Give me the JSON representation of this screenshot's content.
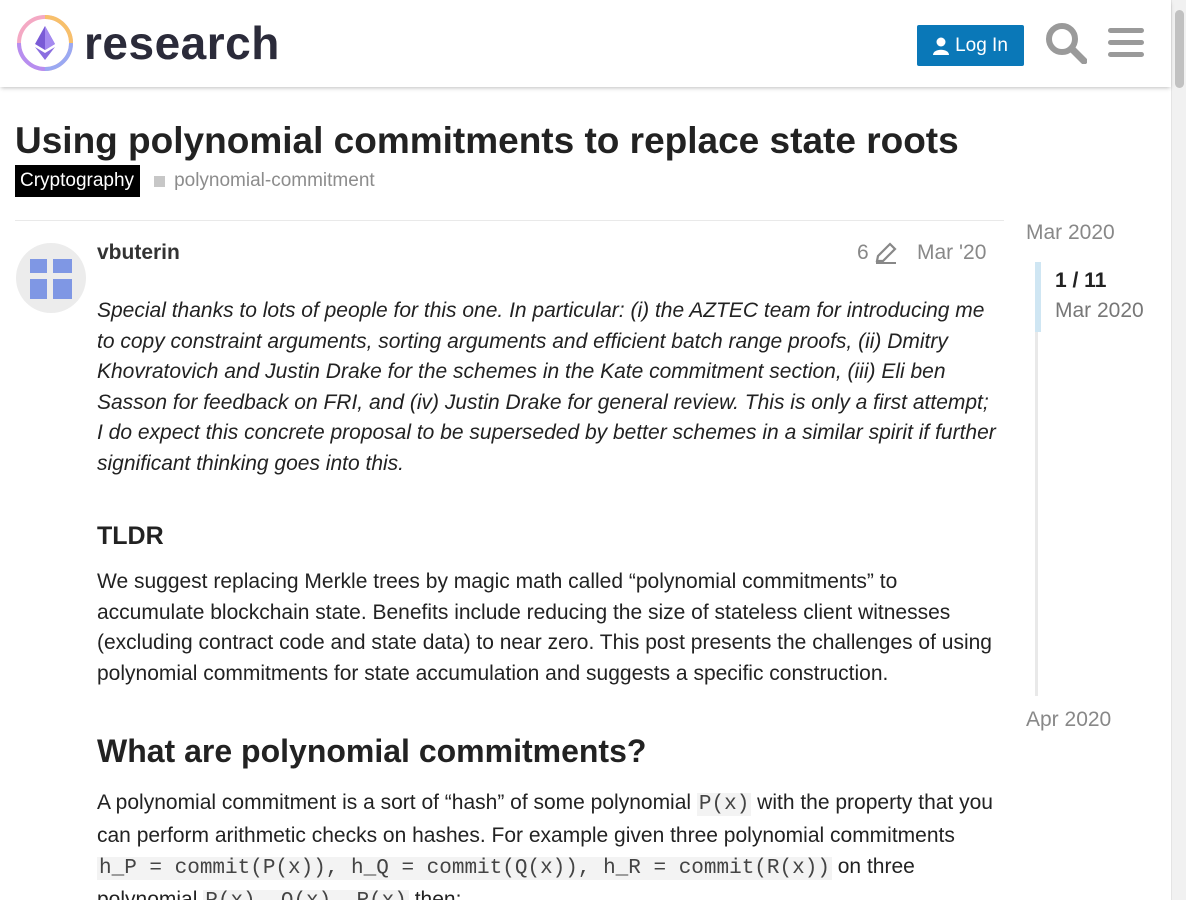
{
  "header": {
    "logo_text": "research",
    "login_label": "Log In",
    "icons": {
      "user": "user-icon",
      "search": "search-icon",
      "menu": "hamburger-menu-icon"
    },
    "accent_color": "#0a78b8"
  },
  "topic": {
    "title": "Using polynomial commitments to replace state roots",
    "category": "Cryptography",
    "tag": "polynomial-commitment"
  },
  "post": {
    "username": "vbuterin",
    "edit_count": "6",
    "date": "Mar '20",
    "thanks": "Special thanks to lots of people for this one. In particular: (i) the AZTEC team for introducing me to copy constraint arguments, sorting arguments and efficient batch range proofs, (ii) Dmitry Khovratovich and Justin Drake for the schemes in the Kate commitment section, (iii) Eli ben Sasson for feedback on FRI, and (iv) Justin Drake for general review. This is only a first attempt; I do expect this concrete proposal to be superseded by better schemes in a similar spirit if further significant thinking goes into this.",
    "tldr_heading": "TLDR",
    "tldr_text": "We suggest replacing Merkle trees by magic math called “polynomial commitments” to accumulate blockchain state. Benefits include reducing the size of stateless client witnesses (excluding contract code and state data) to near zero. This post presents the challenges of using polynomial commitments for state accumulation and suggests a specific construction.",
    "what_heading": "What are polynomial commitments?",
    "what_p1": "A polynomial commitment is a sort of “hash” of some polynomial ",
    "what_code1": "P(x)",
    "what_p2": " with the property that you can perform arithmetic checks on hashes. For example given three polynomial commitments ",
    "what_code2": "h_P = commit(P(x)), h_Q = commit(Q(x)), h_R = commit(R(x))",
    "what_p3": " on three polynomial ",
    "what_code3": "P(x), Q(x), R(x)",
    "what_p4": " then:"
  },
  "timeline": {
    "start": "Mar 2020",
    "position": "1 / 11",
    "position_date": "Mar 2020",
    "end": "Apr 2020"
  }
}
